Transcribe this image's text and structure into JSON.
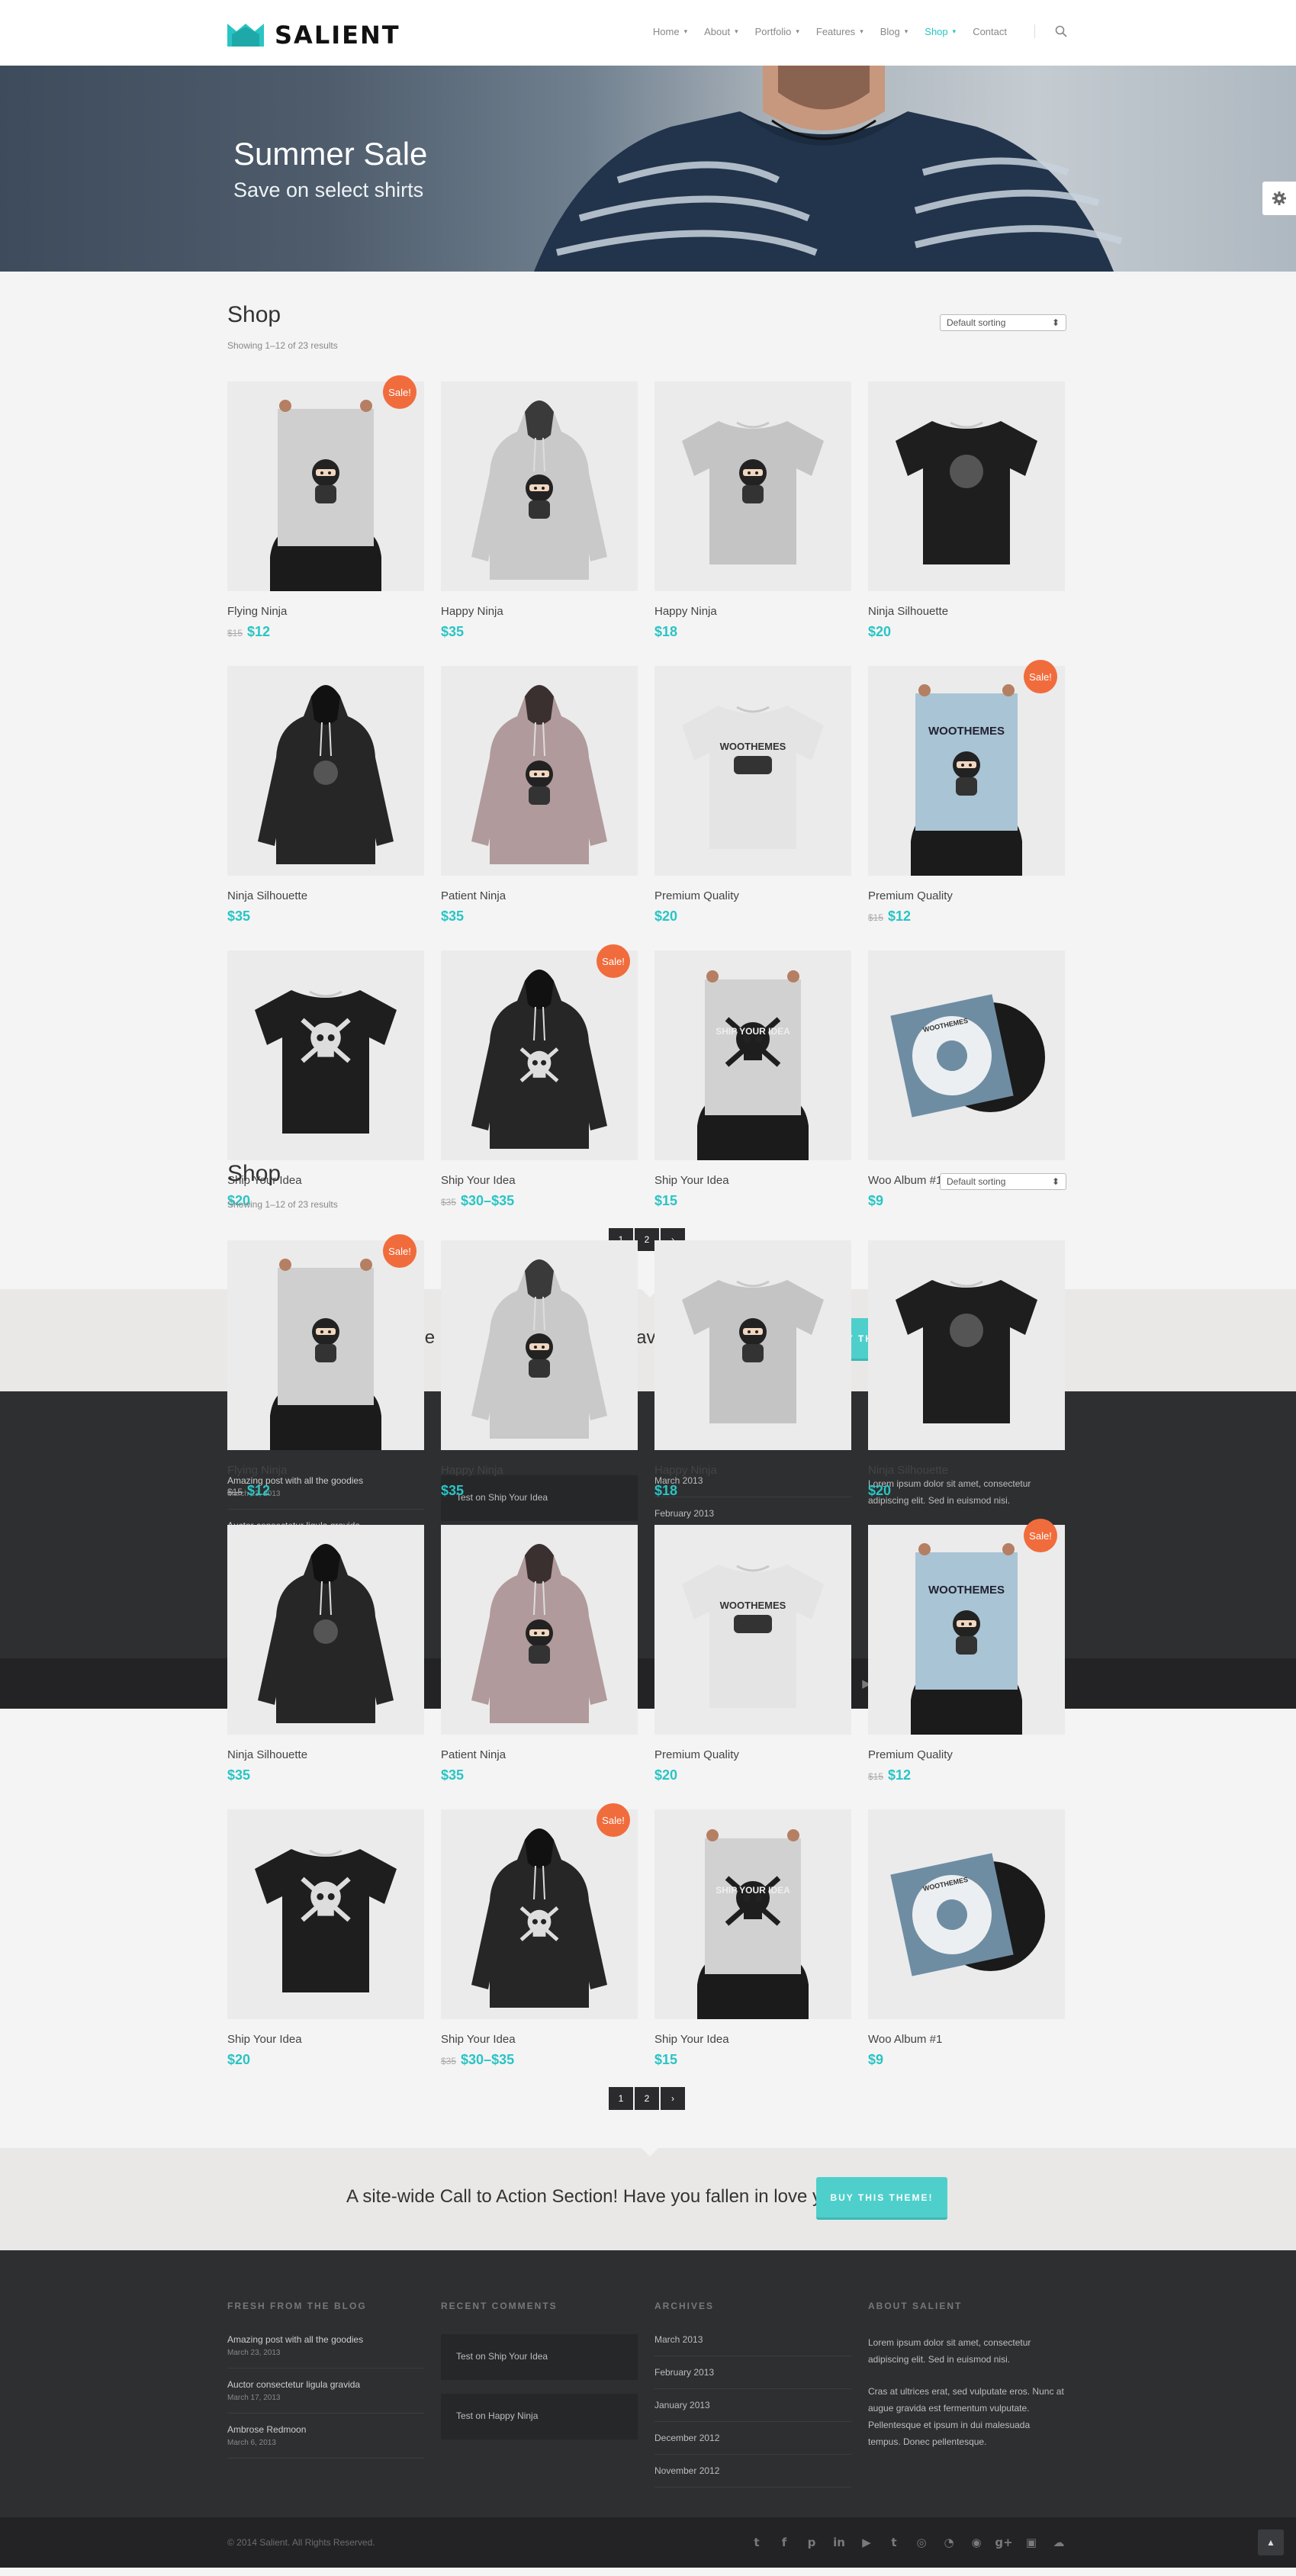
{
  "site": {
    "logo_text": "SALIENT"
  },
  "nav": {
    "items": [
      {
        "label": "Home",
        "caret": true,
        "active": false
      },
      {
        "label": "About",
        "caret": true,
        "active": false
      },
      {
        "label": "Portfolio",
        "caret": true,
        "active": false
      },
      {
        "label": "Features",
        "caret": true,
        "active": false
      },
      {
        "label": "Blog",
        "caret": true,
        "active": false
      },
      {
        "label": "Shop",
        "caret": true,
        "active": true
      },
      {
        "label": "Contact",
        "caret": false,
        "active": false
      }
    ]
  },
  "hero": {
    "title": "Summer Sale",
    "subtitle": "Save on select shirts"
  },
  "shop": {
    "title": "Shop",
    "result_count": "Showing 1–12 of 23 results",
    "sort_value": "Default sorting",
    "sale_label": "Sale!",
    "products": [
      {
        "name": "Flying Ninja",
        "old_price": "$15",
        "price": "$12",
        "sale": true,
        "kind": "poster-ninja"
      },
      {
        "name": "Happy Ninja",
        "old_price": "",
        "price": "$35",
        "sale": false,
        "kind": "hoodie-grey"
      },
      {
        "name": "Happy Ninja",
        "old_price": "",
        "price": "$18",
        "sale": false,
        "kind": "tee-grey"
      },
      {
        "name": "Ninja Silhouette",
        "old_price": "",
        "price": "$20",
        "sale": false,
        "kind": "tee-black"
      },
      {
        "name": "Ninja Silhouette",
        "old_price": "",
        "price": "$35",
        "sale": false,
        "kind": "hoodie-black"
      },
      {
        "name": "Patient Ninja",
        "old_price": "",
        "price": "$35",
        "sale": false,
        "kind": "hoodie-pink"
      },
      {
        "name": "Premium Quality",
        "old_price": "",
        "price": "$20",
        "sale": false,
        "kind": "tee-white"
      },
      {
        "name": "Premium Quality",
        "old_price": "$15",
        "price": "$12",
        "sale": true,
        "kind": "poster-blue"
      },
      {
        "name": "Ship Your Idea",
        "old_price": "",
        "price": "$20",
        "sale": false,
        "kind": "tee-black-skull"
      },
      {
        "name": "Ship Your Idea",
        "old_price": "$35",
        "price": "$30–$35",
        "sale": true,
        "kind": "hoodie-black-skull"
      },
      {
        "name": "Ship Your Idea",
        "old_price": "",
        "price": "$15",
        "sale": false,
        "kind": "poster-skull"
      },
      {
        "name": "Woo Album #1",
        "old_price": "",
        "price": "$9",
        "sale": false,
        "kind": "album"
      }
    ],
    "pagination": [
      "1",
      "2",
      "›"
    ]
  },
  "cta": {
    "text": "A site-wide Call to Action Section! Have you fallen in love yet?",
    "button": "BUY THIS THEME!"
  },
  "footer": {
    "blog_heading": "FRESH FROM THE BLOG",
    "blog": [
      {
        "title": "Amazing post with all the goodies",
        "date": "March 23, 2013"
      },
      {
        "title": "Auctor consectetur ligula gravida",
        "date": "March 17, 2013"
      },
      {
        "title": "Ambrose Redmoon",
        "date": "March 6, 2013"
      }
    ],
    "comments_heading": "RECENT COMMENTS",
    "comments": [
      "Test on Ship Your Idea",
      "Test on Happy Ninja"
    ],
    "archives_heading": "ARCHIVES",
    "archives": [
      "March 2013",
      "February 2013",
      "January 2013",
      "December 2012",
      "November 2012"
    ],
    "about_heading": "ABOUT SALIENT",
    "about_p1": "Lorem ipsum dolor sit amet, consectetur adipiscing elit. Sed in euismod nisi.",
    "about_p2": "Cras at ultrices erat, sed vulputate eros. Nunc at augue gravida est fermentum vulputate. Pellentesque et ipsum in dui malesuada tempus. Donec pellentesque.",
    "copyright": "© 2014 Salient. All Rights Reserved.",
    "social": [
      "twitter-icon",
      "facebook-icon",
      "pinterest-icon",
      "linkedin-icon",
      "youtube-icon",
      "tumblr-icon",
      "dribbble-icon",
      "rss-icon",
      "github-icon",
      "google-plus-icon",
      "instagram-icon",
      "soundcloud-icon"
    ]
  },
  "colors": {
    "accent": "#2ac4c4",
    "sale": "#f16c3c",
    "cta_button": "#4fcfcb",
    "footer_bg": "#2e2f31"
  }
}
